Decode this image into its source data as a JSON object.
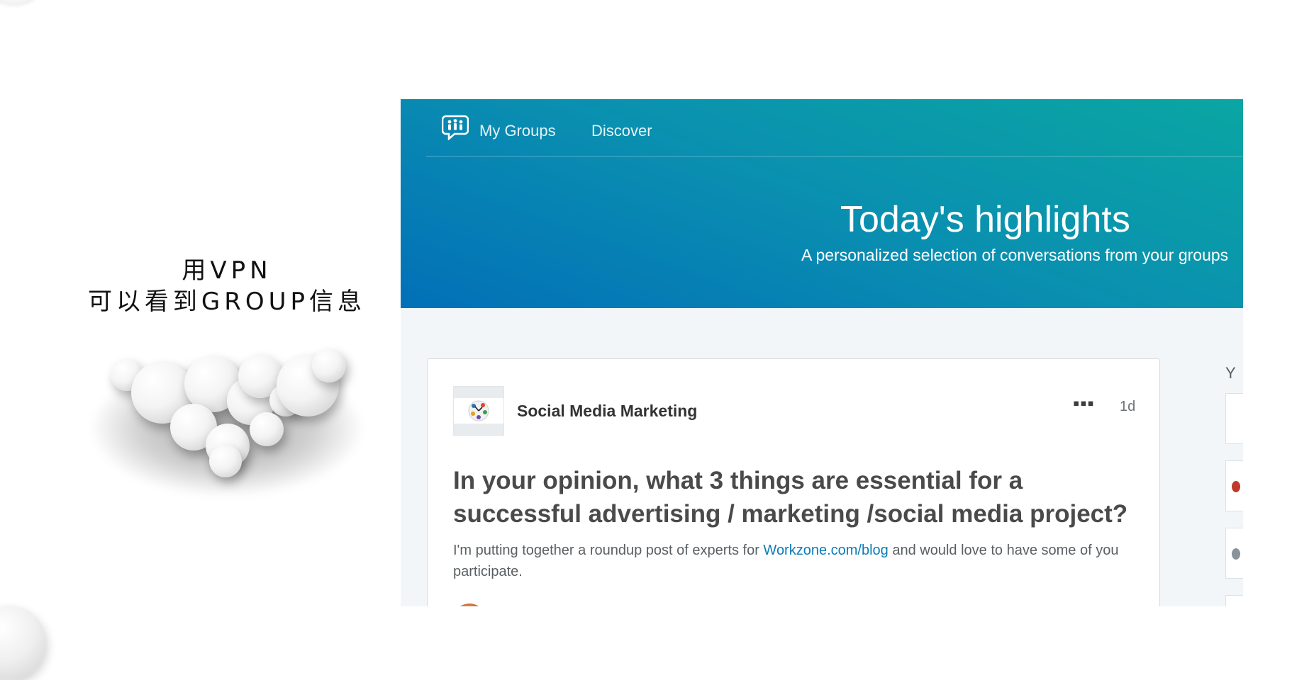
{
  "caption": {
    "line1": "用VPN",
    "line2": "可以看到GROUP信息"
  },
  "nav": {
    "logo_icon": "groups-chat-icon",
    "items": [
      {
        "label": "My Groups"
      },
      {
        "label": "Discover"
      }
    ]
  },
  "hero": {
    "title": "Today's highlights",
    "subtitle": "A personalized selection of conversations from your groups"
  },
  "post": {
    "group_name": "Social Media Marketing",
    "group_logo_icon": "social-media-marketing-logo",
    "more_icon": "more-options-icon",
    "more_glyph": "▪▪▪",
    "age": "1d",
    "title": "In your opinion, what 3 things are essential for a successful advertising / marketing /social media project?",
    "body_before": "I'm putting together a roundup post of experts for ",
    "body_link": "Workzone.com/blog",
    "body_after": " and would love to have some of you participate."
  },
  "sidebar": {
    "heading_fragment": "Y"
  },
  "colors": {
    "hero_teal": "#0aa6a3",
    "hero_blue": "#0270b8",
    "link": "#0a7bb8",
    "page_bg": "#f3f6f8"
  }
}
